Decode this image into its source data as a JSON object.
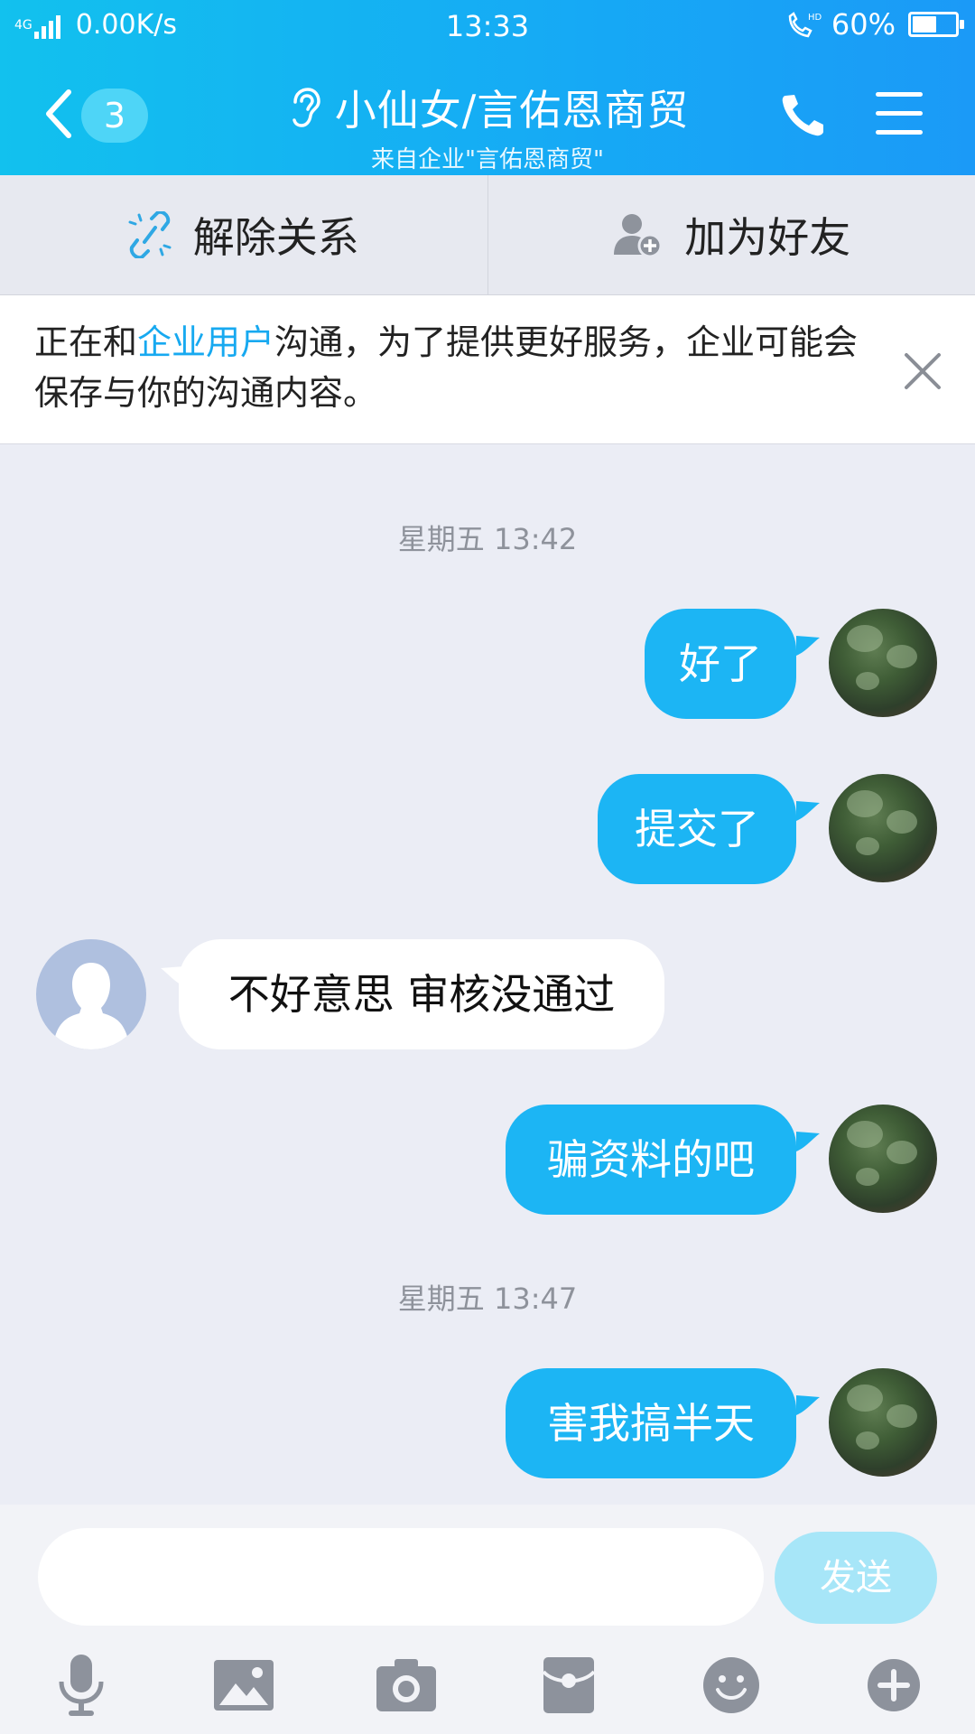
{
  "status_bar": {
    "network": "4G",
    "speed": "0.00K/s",
    "time": "13:33",
    "battery": "60%",
    "battery_level": 0.6
  },
  "header": {
    "unread_count": "3",
    "title": "小仙女/言佑恩商贸",
    "subtitle": "来自企业\"言佑恩商贸\""
  },
  "actions": {
    "unlink": "解除关系",
    "add_friend": "加为好友"
  },
  "notice": {
    "prefix": "正在和",
    "highlight": "企业用户",
    "suffix": "沟通，为了提供更好服务，企业可能会保存与你的沟通内容。"
  },
  "messages": [
    {
      "type": "time",
      "text": "星期五 13:42"
    },
    {
      "type": "out",
      "text": "好了"
    },
    {
      "type": "out",
      "text": "提交了"
    },
    {
      "type": "in",
      "text": "不好意思 审核没通过"
    },
    {
      "type": "out",
      "text": "骗资料的吧"
    },
    {
      "type": "time",
      "text": "星期五 13:47"
    },
    {
      "type": "out",
      "text": "害我搞半天"
    }
  ],
  "composer": {
    "input_value": "",
    "send_label": "发送"
  },
  "toolbar_icons": [
    "microphone-icon",
    "image-icon",
    "camera-icon",
    "red-packet-icon",
    "emoji-icon",
    "plus-icon"
  ],
  "colors": {
    "header_start": "#12C1EE",
    "header_end": "#1B9AF7",
    "bubble_out": "#1CB5F4",
    "accent": "#17A9F0",
    "background": "#EBEDF5"
  }
}
